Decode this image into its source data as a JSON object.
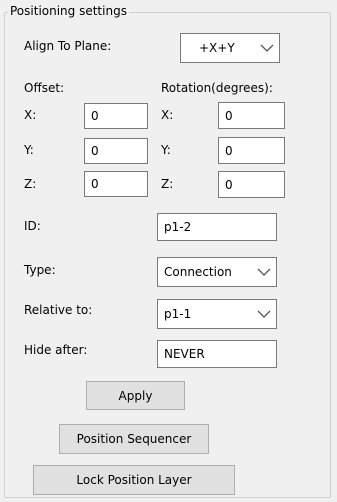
{
  "group_title": "Positioning settings",
  "align": {
    "label": "Align To Plane:",
    "value": "+X+Y"
  },
  "offset": {
    "label": "Offset:",
    "x_label": "X:",
    "x_value": "0",
    "y_label": "Y:",
    "y_value": "0",
    "z_label": "Z:",
    "z_value": "0"
  },
  "rotation": {
    "label": "Rotation(degrees):",
    "x_label": "X:",
    "x_value": "0",
    "y_label": "Y:",
    "y_value": "0",
    "z_label": "Z:",
    "z_value": "0"
  },
  "id": {
    "label": "ID:",
    "value": "p1-2"
  },
  "type": {
    "label": "Type:",
    "value": "Connection"
  },
  "relative_to": {
    "label": "Relative to:",
    "value": "p1-1"
  },
  "hide_after": {
    "label": "Hide after:",
    "value": "NEVER"
  },
  "buttons": {
    "apply": "Apply",
    "position_sequencer": "Position Sequencer",
    "lock_position_layer": "Lock Position Layer"
  },
  "icons": {
    "dropdown": "chevron-down-icon"
  }
}
